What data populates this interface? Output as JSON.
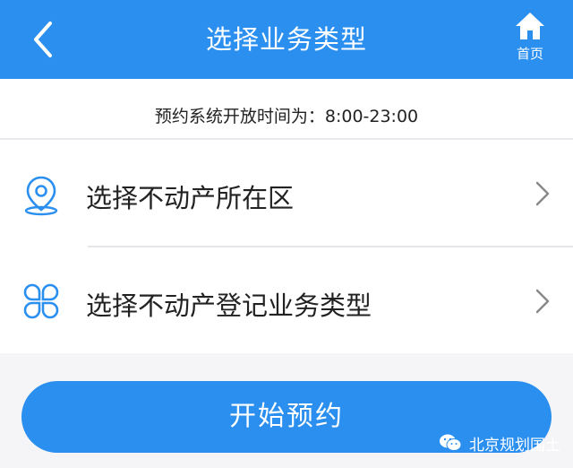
{
  "header": {
    "title": "选择业务类型",
    "home_label": "首页",
    "back_icon": "chevron-left-icon",
    "home_icon": "home-icon",
    "bg_color": "#2b8ff0"
  },
  "notice": {
    "text": "预约系统开放时间为：8:00-23:00"
  },
  "list": {
    "items": [
      {
        "label": "选择不动产所在区",
        "icon": "location-pin-icon"
      },
      {
        "label": "选择不动产登记业务类型",
        "icon": "clover-grid-icon"
      }
    ]
  },
  "actions": {
    "start_label": "开始预约"
  },
  "watermark": {
    "text": "北京规划国土",
    "icon": "wechat-icon"
  }
}
